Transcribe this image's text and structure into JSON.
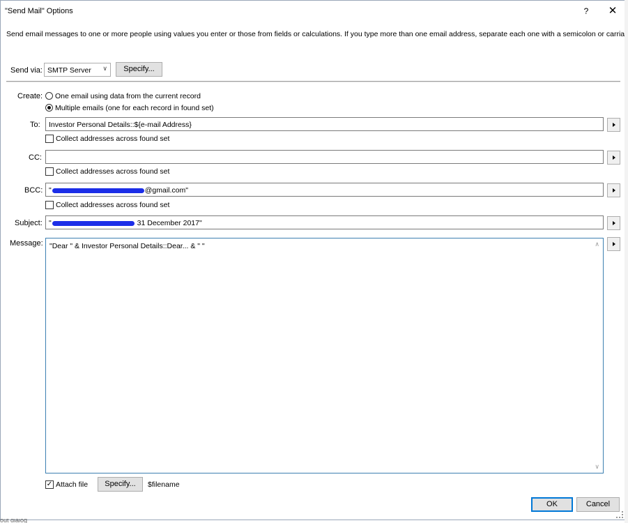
{
  "window": {
    "title": "\"Send Mail\" Options",
    "help_glyph": "?",
    "close_glyph": "✕"
  },
  "description": "Send email messages to one or more people using values you enter or those from fields or calculations. If you type more than one email address, separate each one with a semicolon or carriage return.",
  "send_via": {
    "label": "Send via:",
    "value": "SMTP Server",
    "chevron": "∨",
    "specify_label": "Specify..."
  },
  "create": {
    "label": "Create:",
    "options": [
      {
        "label": "One email using data from the current record",
        "selected": false
      },
      {
        "label": "Multiple emails (one for each record in found set)",
        "selected": true
      }
    ]
  },
  "fields": {
    "to": {
      "label": "To:",
      "value": "Investor Personal Details::${e-mail Address}",
      "collect_label": "Collect addresses across found set"
    },
    "cc": {
      "label": "CC:",
      "value": "",
      "collect_label": "Collect addresses across found set"
    },
    "bcc": {
      "label": "BCC:",
      "value_prefix": "\"",
      "value_suffix": "@gmail.com\"",
      "collect_label": "Collect addresses across found set"
    },
    "subject": {
      "label": "Subject:",
      "value_prefix": "\"",
      "value_suffix": " 31 December 2017\""
    },
    "message": {
      "label": "Message:",
      "value": "\"Dear \" & Investor Personal Details::Dear... & \" \""
    }
  },
  "scroll": {
    "up": "∧",
    "down": "∨"
  },
  "attach": {
    "label": "Attach file",
    "checked": true,
    "check_glyph": "✓",
    "specify_label": "Specify...",
    "filename": "$filename"
  },
  "buttons": {
    "ok": "OK",
    "cancel": "Cancel"
  },
  "background_text": "out dialog"
}
